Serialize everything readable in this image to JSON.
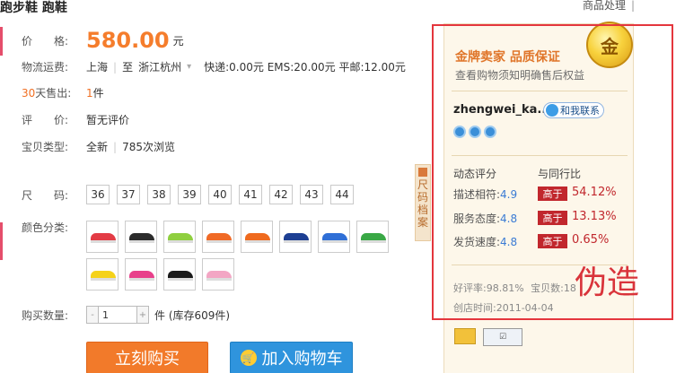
{
  "product": {
    "title": "跑步鞋 跑鞋"
  },
  "top_link": {
    "label": "商品处理",
    "bar": "|"
  },
  "price": {
    "label": "价　　格:",
    "value": "580.00",
    "unit": "元"
  },
  "shipping": {
    "label": "物流运费:",
    "origin": "上海",
    "to_word": "至",
    "destination": "浙江杭州",
    "fees": "快递:0.00元 EMS:20.00元 平邮:12.00元"
  },
  "sales": {
    "days": "30",
    "label_rest": "天售出:",
    "count": "1",
    "count_unit": "件"
  },
  "review": {
    "label": "评　　价:",
    "value": "暂无评价"
  },
  "item_type": {
    "label": "宝贝类型:",
    "condition": "全新",
    "views": "785次浏览"
  },
  "sizes": {
    "label": "尺　　码:",
    "options": [
      "36",
      "37",
      "38",
      "39",
      "40",
      "41",
      "42",
      "43",
      "44"
    ]
  },
  "colors": {
    "label": "颜色分类:",
    "swatch_colors": [
      "#e33b45",
      "#2c2c2c",
      "#8fcf3f",
      "#f06a26",
      "#ef6a1e",
      "#1d3f93",
      "#2f6fd6",
      "#39a845",
      "#f5d21a",
      "#e8408b",
      "#1a1a1a",
      "#f3a6c4"
    ]
  },
  "quantity": {
    "label": "购买数量:",
    "minus": "-",
    "value": "1",
    "plus": "+",
    "suffix": "件 (库存609件)"
  },
  "buttons": {
    "buy": "立刻购买",
    "cart": "加入购物车",
    "cart_icon": "shopping-cart-icon"
  },
  "size_tab": {
    "label": "尺码档案"
  },
  "seller": {
    "badge_title": "金牌卖家 品质保证",
    "badge_sub": "查看购物须知明确售后权益",
    "medal_text": "金",
    "name": "zhengwei_ka...",
    "contact_label": "和我联系",
    "dsr_header": "动态评分",
    "dsr_compare_header": "与同行比",
    "dsr": [
      {
        "name": "描述相符:",
        "score": "4.9",
        "badge": "高于",
        "pct": "54.12%"
      },
      {
        "name": "服务态度:",
        "score": "4.8",
        "badge": "高于",
        "pct": "13.13%"
      },
      {
        "name": "发货速度:",
        "score": "4.8",
        "badge": "高于",
        "pct": "0.65%"
      }
    ],
    "good_rate": "好评率:98.81%",
    "items_count": "宝贝数:",
    "items_count_value": "18",
    "shop_created": "创店时间:2011-04-04"
  },
  "annotation": {
    "label": "伪造",
    "frame_color": "#e4363d"
  }
}
